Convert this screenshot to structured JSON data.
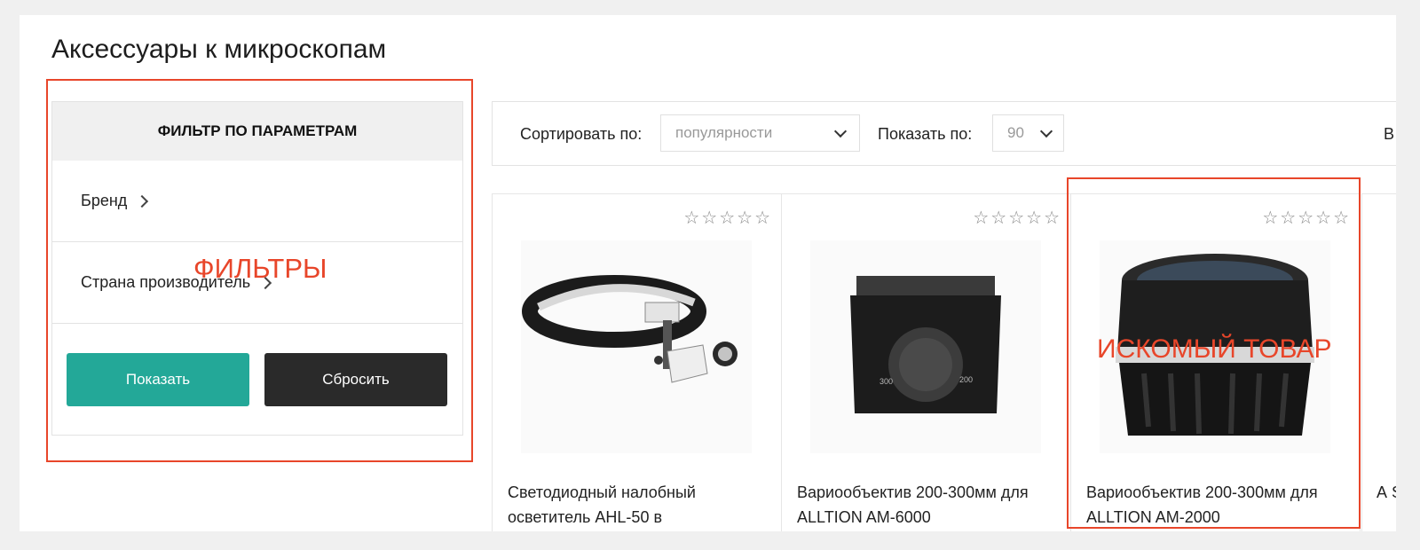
{
  "page": {
    "title": "Аксессуары к микроскопам"
  },
  "filter": {
    "header": "ФИЛЬТР ПО ПАРАМЕТРАМ",
    "items": [
      {
        "label": "Бренд"
      },
      {
        "label": "Страна производитель"
      }
    ],
    "show_button": "Показать",
    "reset_button": "Сбросить"
  },
  "toolbar": {
    "sort_label": "Сортировать по:",
    "sort_value": "популярности",
    "show_label": "Показать по:",
    "show_value": "90",
    "extra_cut": "В"
  },
  "products": [
    {
      "name": "Светодиодный налобный осветитель AHL-50 в",
      "rating": 0,
      "stars_max": 5
    },
    {
      "name": "Вариообъектив 200-300мм для ALLTION AM-6000",
      "rating": 0,
      "stars_max": 5
    },
    {
      "name": "Вариообъектив 200-300мм для ALLTION AM-2000",
      "rating": 0,
      "stars_max": 5
    }
  ],
  "edge_product": {
    "name_start": "А S"
  },
  "annotations": {
    "filters_label": "ФИЛЬТРЫ",
    "target_label": "ИСКОМЫЙ ТОВАР",
    "color": "#e8462a"
  },
  "colors": {
    "accent_button": "#23a898",
    "dark_button": "#2a2a2a"
  }
}
